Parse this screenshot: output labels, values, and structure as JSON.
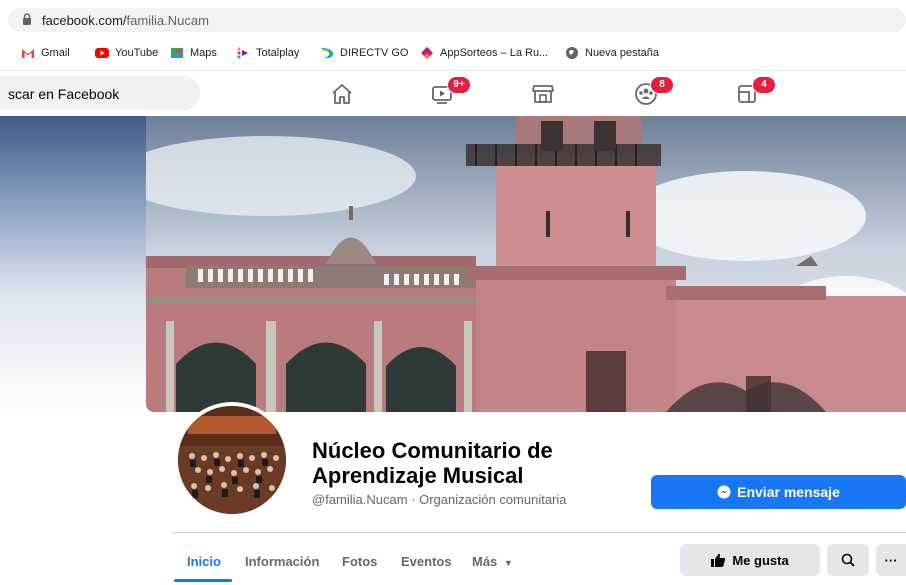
{
  "browser": {
    "url_host": "facebook.com/",
    "url_path": "familia.Nucam",
    "bookmarks": [
      {
        "label": "Gmail",
        "icon": "gmail-icon"
      },
      {
        "label": "YouTube",
        "icon": "youtube-icon"
      },
      {
        "label": "Maps",
        "icon": "maps-icon"
      },
      {
        "label": "Totalplay",
        "icon": "totalplay-icon"
      },
      {
        "label": "DIRECTV GO",
        "icon": "directv-icon"
      },
      {
        "label": "AppSorteos – La Ru...",
        "icon": "appsorteos-icon"
      },
      {
        "label": "Nueva pestaña",
        "icon": "globe-icon"
      }
    ]
  },
  "facebook": {
    "search_placeholder": "scar en Facebook",
    "nav_badges": {
      "watch": "9+",
      "groups": "8",
      "gaming": "4"
    },
    "page": {
      "name_line1": "Núcleo Comunitario de",
      "name_line2": "Aprendizaje Musical",
      "subtitle": "@familia.Nucam · Organización comunitaria",
      "send_message": "Enviar mensaje",
      "tabs": [
        "Inicio",
        "Información",
        "Fotos",
        "Eventos",
        "Más"
      ],
      "like": "Me gusta",
      "more": "···"
    }
  },
  "colors": {
    "brand": "#1877f2",
    "badge": "#e41e3f"
  }
}
